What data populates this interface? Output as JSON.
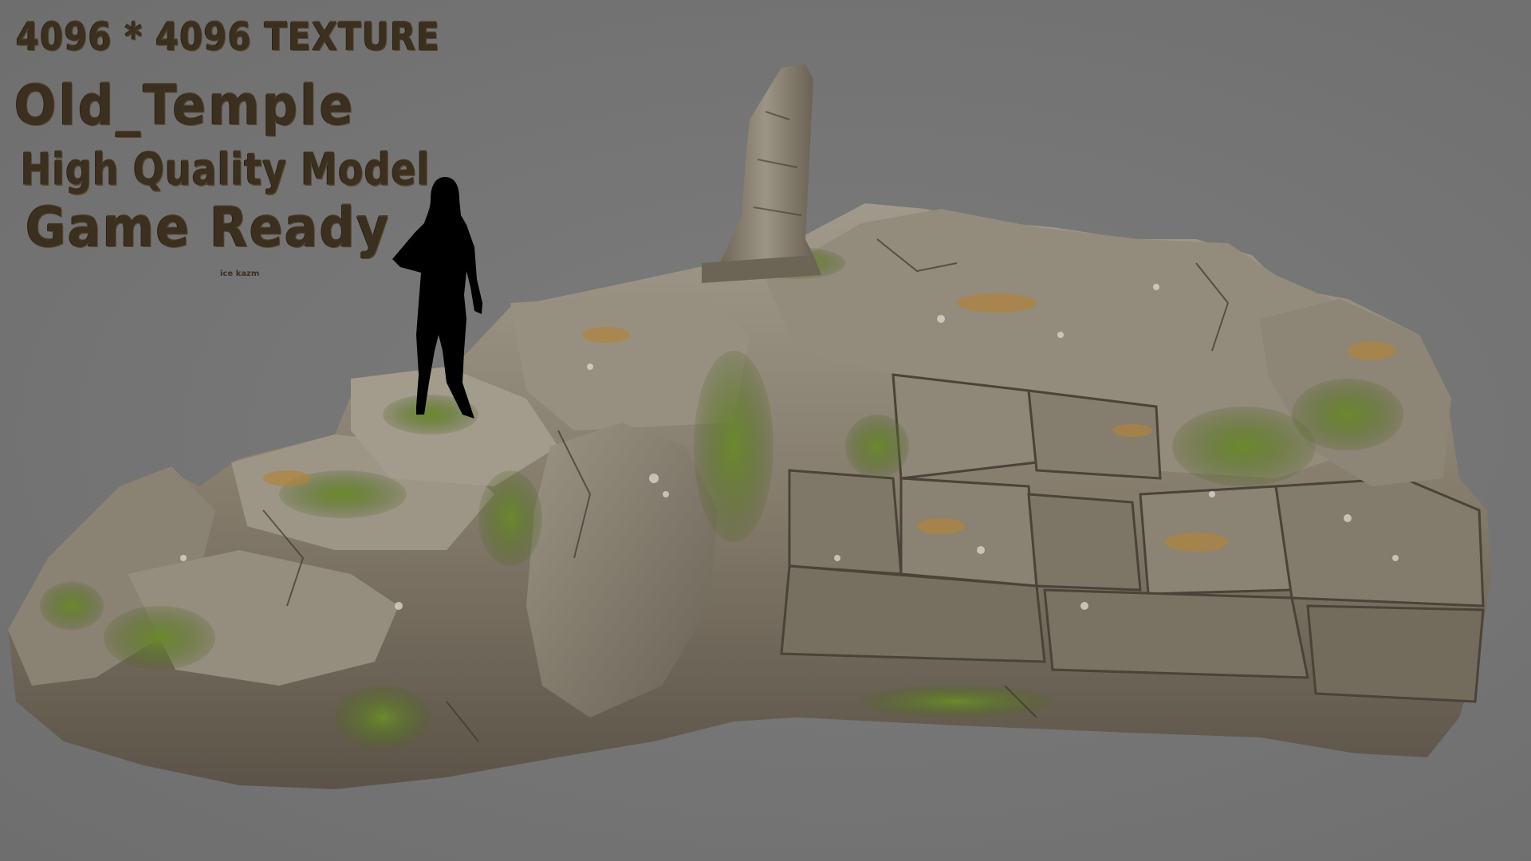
{
  "promo": {
    "texture": "4096 * 4096 TEXTURE",
    "title": "Old_Temple",
    "quality": "High Quality Model",
    "ready": "Game Ready",
    "credit": "ice kazm"
  },
  "colors": {
    "background": "#767676",
    "text": "#3b2f1f",
    "rock_light": "#9a9385",
    "rock_mid": "#7d7566",
    "rock_dark": "#4e473c",
    "moss": "#5f7a2a",
    "lichen": "#b0833c",
    "silhouette": "#000000"
  }
}
